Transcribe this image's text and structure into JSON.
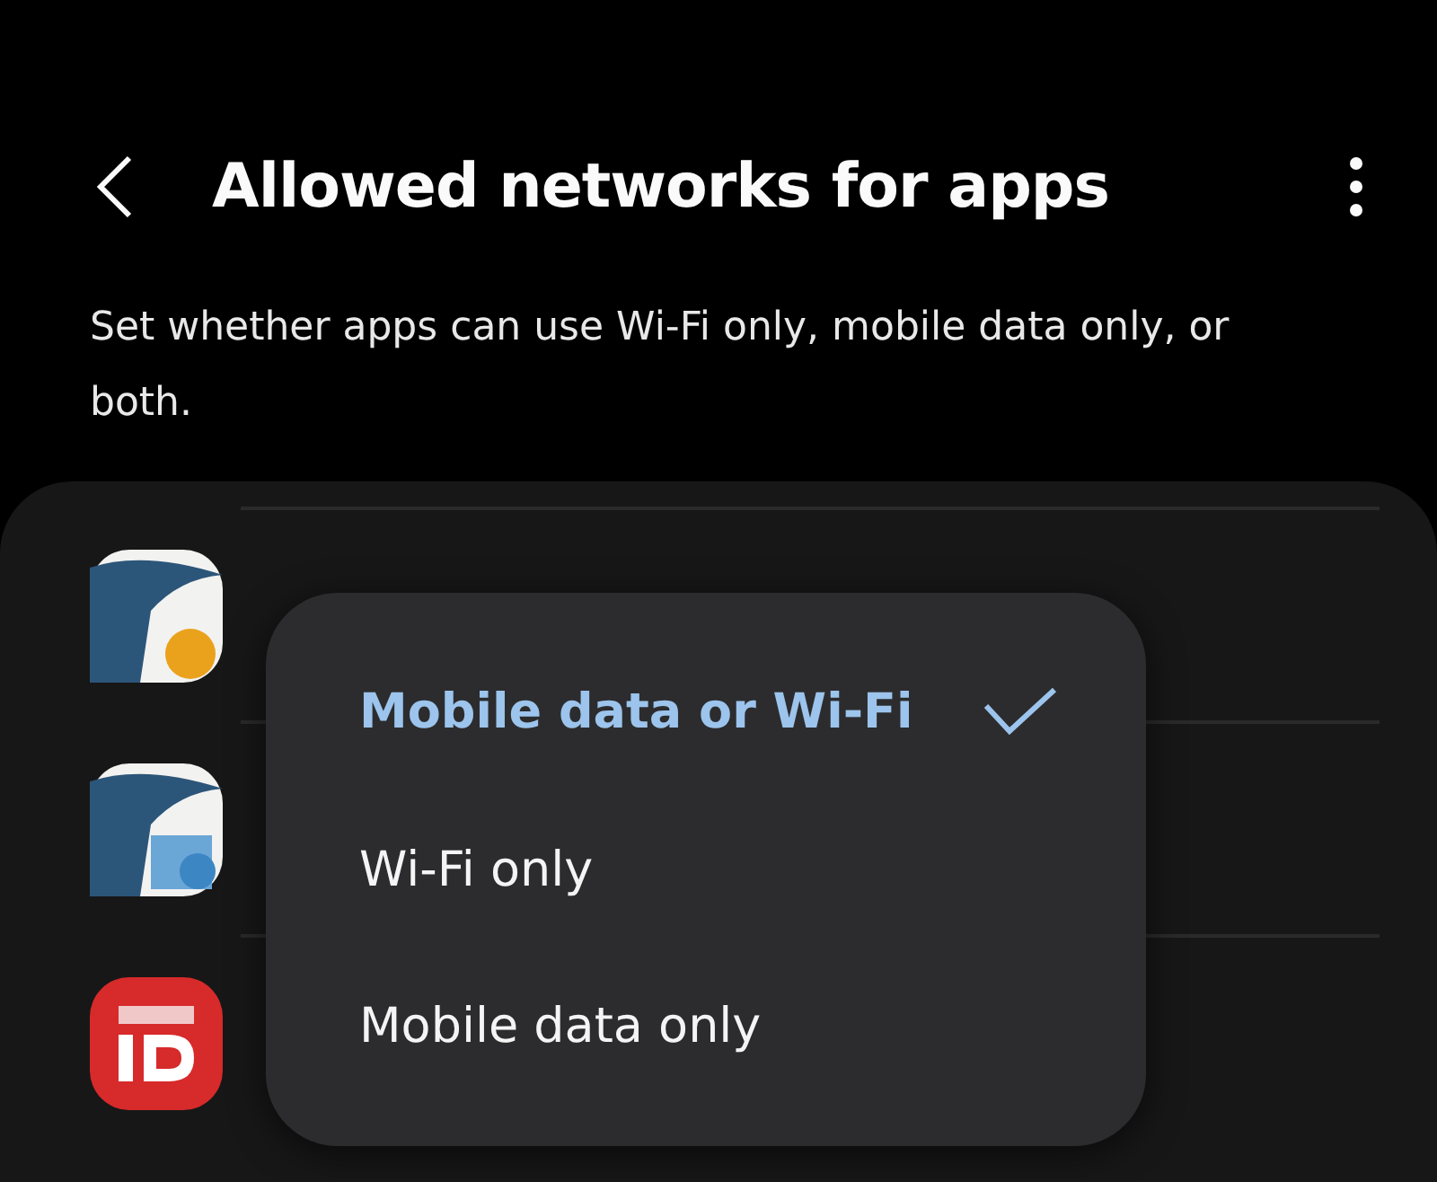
{
  "header": {
    "title": "Allowed networks for apps"
  },
  "description": "Set whether apps can use Wi-Fi only, mobile data only, or both.",
  "apps": [
    {
      "kind": "bird-sun"
    },
    {
      "kind": "bird-coins"
    },
    {
      "kind": "red-id"
    }
  ],
  "menu": {
    "options": [
      {
        "label": "Mobile data or Wi-Fi",
        "selected": true
      },
      {
        "label": "Wi-Fi only",
        "selected": false
      },
      {
        "label": "Mobile data only",
        "selected": false
      }
    ]
  }
}
